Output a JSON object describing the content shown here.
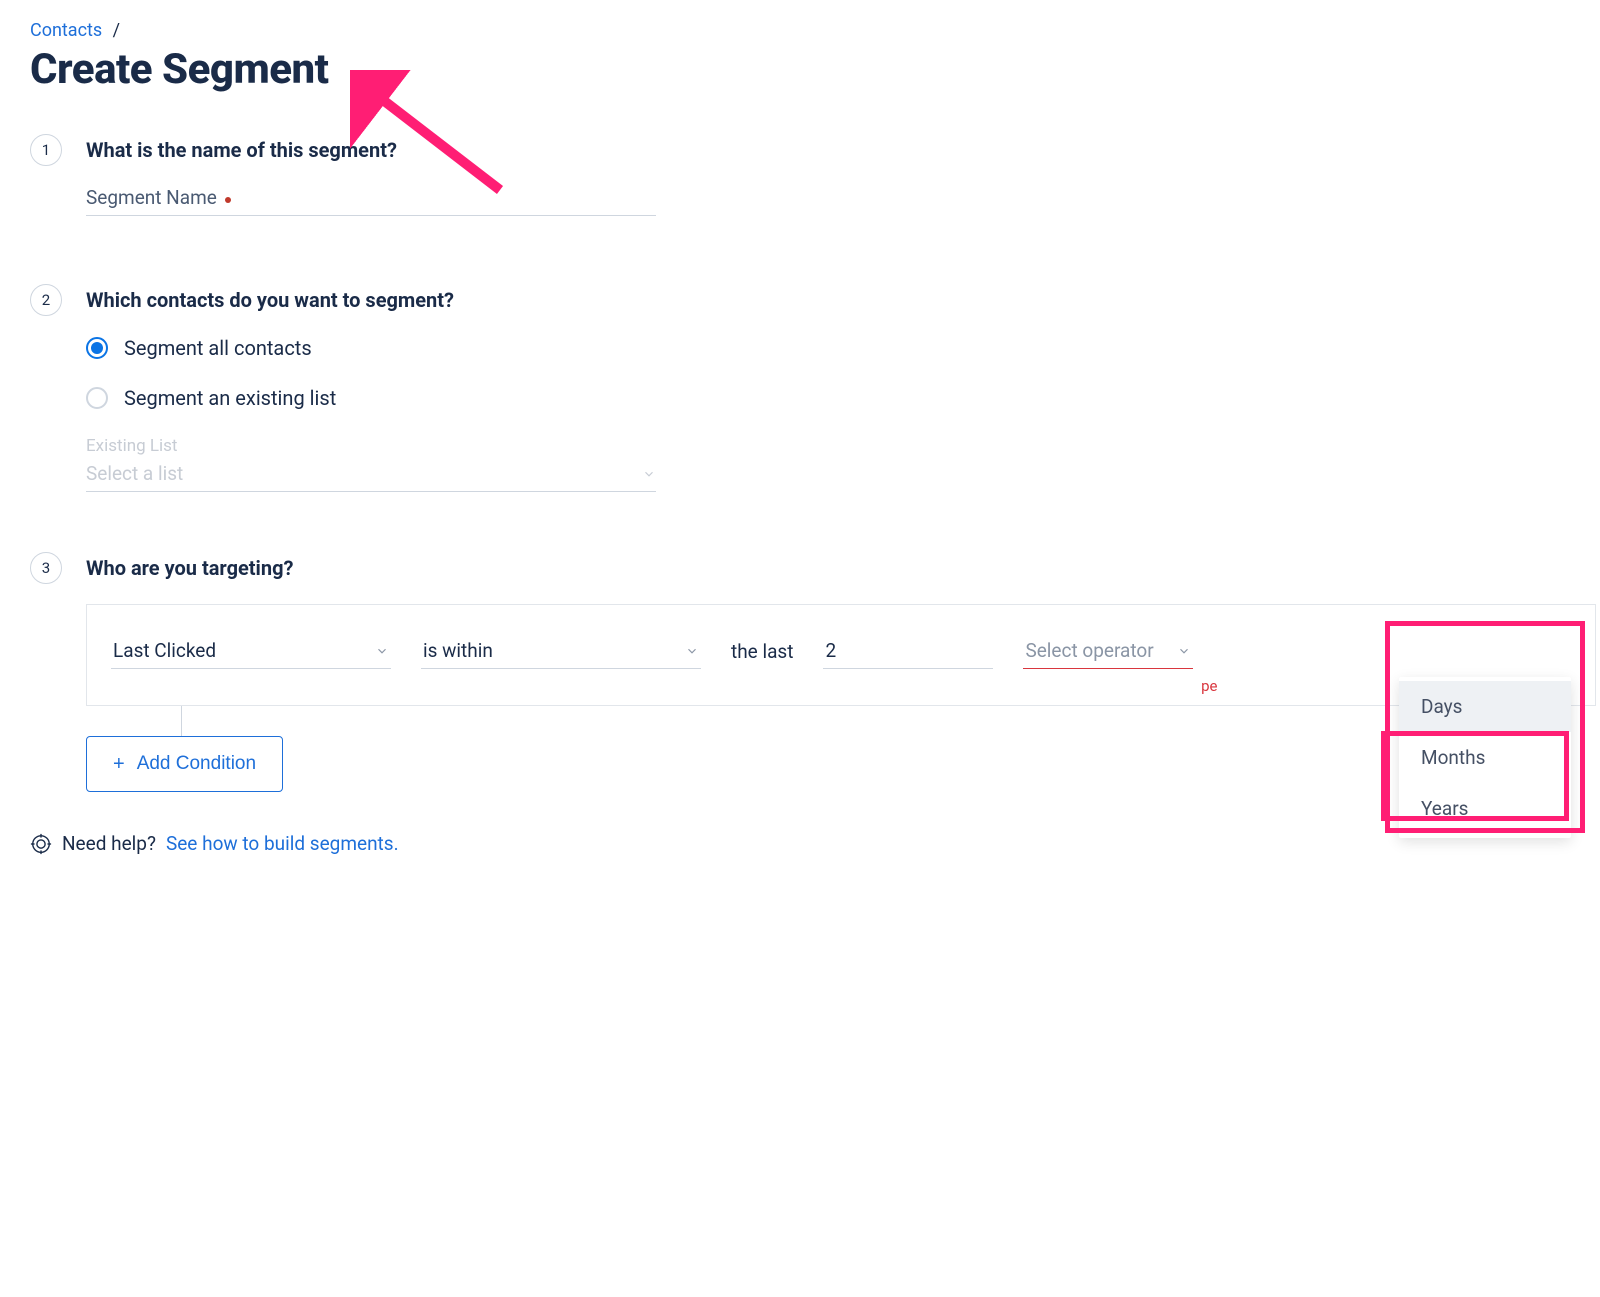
{
  "breadcrumb": {
    "link": "Contacts",
    "sep": "/"
  },
  "page_title": "Create Segment",
  "steps": {
    "s1": {
      "num": "1",
      "title": "What is the name of this segment?",
      "field_label": "Segment Name"
    },
    "s2": {
      "num": "2",
      "title": "Which contacts do you want to segment?",
      "opt_all": "Segment all contacts",
      "opt_existing": "Segment an existing list",
      "existing_label": "Existing List",
      "existing_placeholder": "Select a list"
    },
    "s3": {
      "num": "3",
      "title": "Who are you targeting?",
      "field": "Last Clicked",
      "operator": "is within",
      "static": "the last",
      "value": "2",
      "unit_placeholder": "Select operator",
      "err_fragment": "pe",
      "options": {
        "o1": "Days",
        "o2": "Months",
        "o3": "Years"
      },
      "add_condition": "Add Condition"
    }
  },
  "help": {
    "question": "Need help?",
    "link": "See how to build segments."
  }
}
